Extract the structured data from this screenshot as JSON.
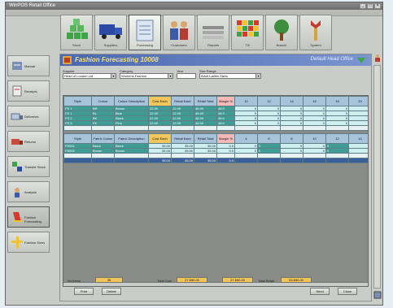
{
  "window": {
    "title": "WinPOS Retail Office"
  },
  "toolbar": [
    {
      "name": "stock",
      "label": "Stock"
    },
    {
      "name": "suppliers",
      "label": "Suppliers"
    },
    {
      "name": "purchasing",
      "label": "Purchasing"
    },
    {
      "name": "customers",
      "label": "Customers"
    },
    {
      "name": "reports",
      "label": "Reports"
    },
    {
      "name": "till",
      "label": "Till"
    },
    {
      "name": "branch",
      "label": "Branch"
    },
    {
      "name": "system",
      "label": "System"
    }
  ],
  "sidebar": [
    {
      "name": "manual",
      "label": "Manual"
    },
    {
      "name": "receipts",
      "label": "Receipts"
    },
    {
      "name": "deliveries",
      "label": "Deliveries"
    },
    {
      "name": "returns",
      "label": "Returns"
    },
    {
      "name": "transfer",
      "label": "Transfer Stock"
    },
    {
      "name": "analysis",
      "label": "Analysis"
    },
    {
      "name": "forecasting",
      "label": "Fashion Forecasting"
    },
    {
      "name": "fashion-sizes",
      "label": "Fashion Sizes"
    }
  ],
  "panel": {
    "title": "Fashion Forecasting 10008",
    "right_title": "Default Head Office"
  },
  "filters": [
    {
      "label": "Supplier",
      "value": "Head of London Ltd"
    },
    {
      "label": "Category",
      "value": "Womens Fashion"
    },
    {
      "label": "Year",
      "value": ""
    },
    {
      "label": "Size Range",
      "value": "Adult Ladies Sizes"
    }
  ],
  "table1": {
    "headers": [
      "Style",
      "Colour",
      "Colour Description",
      "Cost Each",
      "Retail Each",
      "Retail Total",
      "Margin %",
      "10",
      "12",
      "14",
      "16",
      "18",
      "20"
    ],
    "rows": [
      [
        "FS 1",
        "BR",
        "Brown",
        "22.99",
        "12.99",
        "48.99",
        "46.9",
        "0",
        "0",
        "0",
        "0",
        "0",
        "0"
      ],
      [
        "FS 1",
        "BL",
        "Blue",
        "22.99",
        "12.99",
        "48.99",
        "46.9",
        "0",
        "0",
        "0",
        "0",
        "0",
        "0"
      ],
      [
        "FS 2",
        "BK",
        "Black",
        "22.99",
        "12.99",
        "48.99",
        "46.9",
        "0",
        "0",
        "0",
        "0",
        "0",
        "0"
      ],
      [
        "FS 3",
        "PK",
        "Pink",
        "22.99",
        "12.99",
        "48.99",
        "46.9",
        "0",
        "0",
        "0",
        "0",
        "0",
        "0"
      ]
    ]
  },
  "table2": {
    "headers": [
      "Style",
      "Fabric Colour",
      "Fabric Description",
      "Cost Each",
      "Retail Each",
      "Retail Total",
      "Margin %",
      "4",
      "6",
      "8",
      "10",
      "12",
      "14"
    ],
    "rows": [
      [
        "FS001",
        "Black",
        "Black",
        "35.00",
        "35.00",
        "35.00",
        "0.0",
        "0",
        "0",
        "0",
        "0",
        "0",
        "0"
      ],
      [
        "FS002",
        "Brown",
        "Brown",
        "35.00",
        "35.00",
        "35.00",
        "0.0",
        "0",
        "0",
        "0",
        "0",
        "0",
        "0"
      ]
    ],
    "total": [
      "",
      "",
      "",
      "35.00",
      "35.00",
      "35.00",
      "0.0",
      "",
      "",
      "",
      "",
      "",
      ""
    ]
  },
  "footer": {
    "no_items_label": "No Items",
    "no_items_value": "35",
    "total_cost_label": "Total Cost",
    "total_cost_value": "27,650.00",
    "total_cost_value2": "27,650.00",
    "total_retail_label": "Total Retail",
    "total_retail_value": "53,650.00",
    "print_label": "Print",
    "delete_label": "Delete",
    "send_label": "Send",
    "close_label": "Close"
  },
  "colors": {
    "header_blue": "#4a68b0",
    "title_yellow": "#f4e27a",
    "grid_teal": "#3f9c94",
    "cost_yellow": "#f0c75a"
  }
}
